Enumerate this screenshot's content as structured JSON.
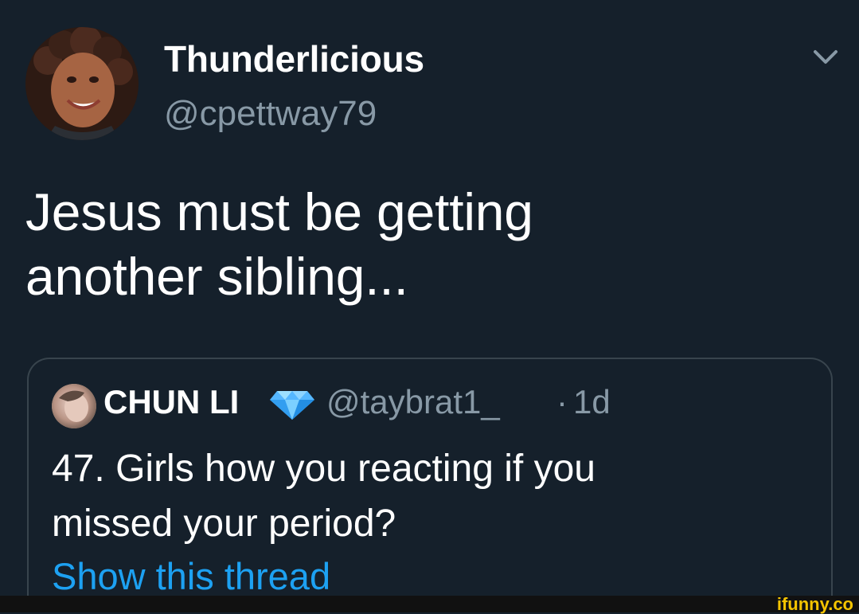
{
  "tweet": {
    "author": {
      "display_name": "Thunderlicious",
      "handle": "@cpettway79",
      "avatar_icon": "profile-photo-icon"
    },
    "text": "Jesus must be getting\nanother sibling...",
    "menu_icon": "chevron-down-icon"
  },
  "quoted_tweet": {
    "author": {
      "display_name": "CHUN LI",
      "handle": "@taybrat1_",
      "separator": "·",
      "time": "1d",
      "avatar_icon": "profile-photo-icon",
      "badge_icon": "diamond-icon"
    },
    "text": "47. Girls how you reacting if you\nmissed your period?",
    "show_thread_label": "Show this thread"
  },
  "watermark": {
    "text": "ifunny.co"
  },
  "colors": {
    "background": "#15202b",
    "secondary_text": "#8899a6",
    "link": "#1da1f2",
    "border": "#38444d",
    "watermark": "#f5c400"
  }
}
